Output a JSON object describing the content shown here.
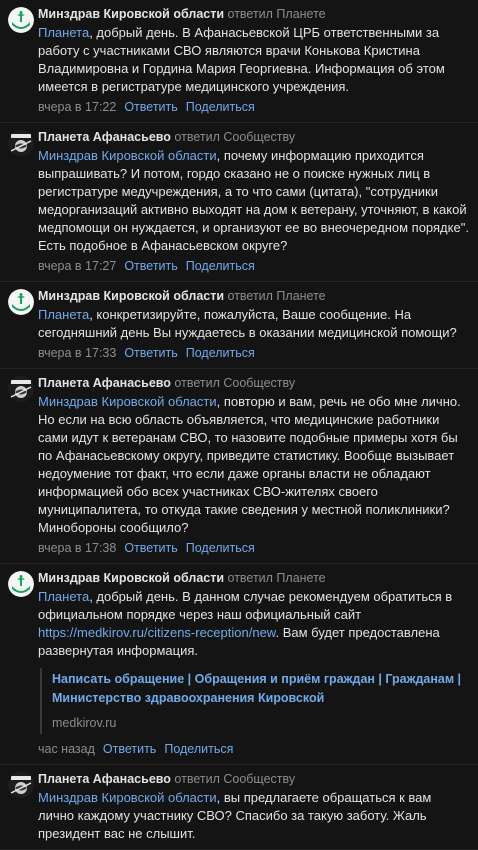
{
  "colors": {
    "background": "#141414",
    "text": "#e1e3e6",
    "muted": "#8a8d91",
    "link": "#71aaeb"
  },
  "actions": {
    "reply": "Ответить",
    "share": "Поделиться"
  },
  "comments": [
    {
      "author": "Минздрав Кировской области",
      "replied": "ответил Планете",
      "mention": "Планета",
      "text": ", добрый день. В Афанасьевской ЦРБ ответственными за работу с участниками СВО являются врачи Конькова Кристина Владимировна и Гордина Мария Георгиевна. Информация об этом имеется в регистратуре медицинского учреждения.",
      "time": "вчера в 17:22",
      "avatar": "ministry-logo-icon"
    },
    {
      "author": "Планета Афанасьево",
      "replied": "ответил Сообществу",
      "mention": "Минздрав Кировской области",
      "text": ", почему информацию приходится выпрашивать? И потом, гордо сказано не о поиске нужных лиц в регистратуре медучреждения, а то что сами (цитата), \"сотрудники медорганизаций активно выходят на дом к ветерану, уточняют, в какой медпомощи он нуждается, и организуют ее во внеочередном порядке\". Есть подобное в Афанасьевском округе?",
      "time": "вчера в 17:27",
      "avatar": "planeta-logo-icon"
    },
    {
      "author": "Минздрав Кировской области",
      "replied": "ответил Планете",
      "mention": "Планета",
      "text": ", конкретизируйте, пожалуйста, Ваше сообщение. На сегодняшний день Вы нуждаетесь в оказании медицинской помощи?",
      "time": "вчера в 17:33",
      "avatar": "ministry-logo-icon"
    },
    {
      "author": "Планета Афанасьево",
      "replied": "ответил Сообществу",
      "mention": "Минздрав Кировской области",
      "text": ", повторю и вам, речь не обо мне лично. Но если на всю область объявляется, что медицинские работники сами идут к ветеранам СВО, то назовите подобные примеры хотя бы по Афанасьевскому округу, приведите статистику. Вообще вызывает недоумение тот факт, что если даже органы власти не обладают информацией обо всех участниках СВО-жителях своего муниципалитета, то откуда такие сведения у местной поликлиники? Минобороны сообщило?",
      "time": "вчера в 17:38",
      "avatar": "planeta-logo-icon"
    },
    {
      "author": "Минздрав Кировской области",
      "replied": "ответил Планете",
      "mention": "Планета",
      "text": ", добрый день. В данном случае рекомендуем обратиться в официальном порядке через наш официальный сайт ",
      "link": "https://medkirov.ru/citizens-reception/new",
      "text_after": ". Вам будет предоставлена развернутая информация.",
      "snippet_title": "Написать обращение | Обращения и приём граждан | Гражданам | Министерство здравоохранения Кировской",
      "snippet_domain": "medkirov.ru",
      "time": "час назад",
      "avatar": "ministry-logo-icon"
    },
    {
      "author": "Планета Афанасьево",
      "replied": "ответил Сообществу",
      "mention": "Минздрав Кировской области",
      "text": ", вы предлагаете обращаться к вам лично каждому участнику СВО? Спасибо за такую заботу. Жаль президент вас не слышит.",
      "avatar": "planeta-logo-icon"
    }
  ]
}
